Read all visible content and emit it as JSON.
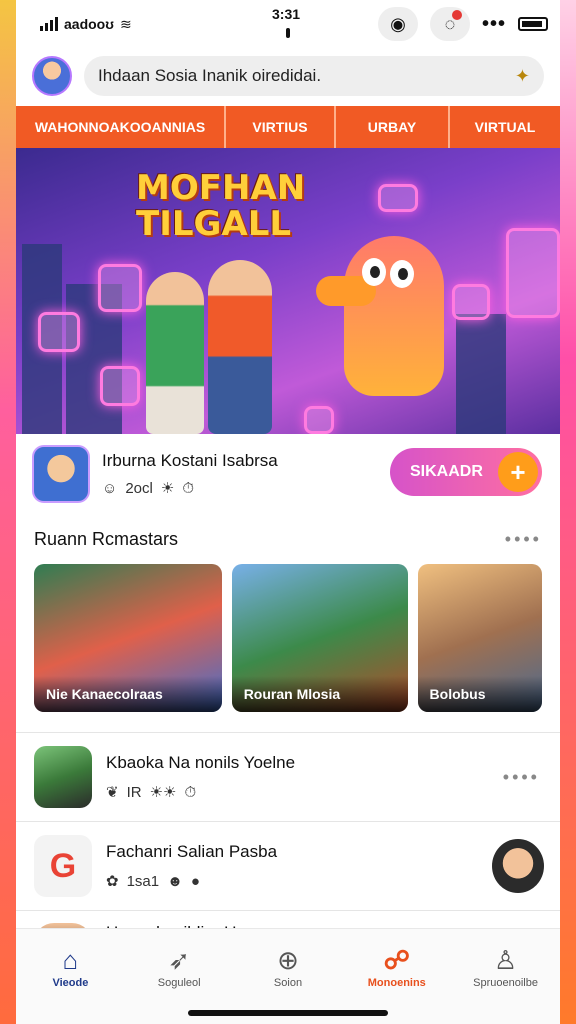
{
  "status": {
    "carrier": "aadooʊ",
    "time": "3:31"
  },
  "search": {
    "placeholder": "Ihdaan Sosia Inanik oiredidai."
  },
  "tabs": [
    {
      "label": "WAHONNOAKOOANNIAS"
    },
    {
      "label": "VIRTIUS"
    },
    {
      "label": "URBAY"
    },
    {
      "label": "VIRTUAL"
    }
  ],
  "hero": {
    "title_line1": "MOFHAN",
    "title_line2": "TILGALL"
  },
  "profile": {
    "name": "Irburna Kostani Isabrsa",
    "meta": "2ocl",
    "cta_label": "SIKAADR",
    "cta_plus": "+"
  },
  "section": {
    "title": "Ruann Rcmastars",
    "more": "••••"
  },
  "cards": [
    {
      "caption": "Nie Kanaecolraas"
    },
    {
      "caption": "Rouran Mlosia"
    },
    {
      "caption": "Bolobus"
    }
  ],
  "list": [
    {
      "title": "Kbaoka Na nonils Yoelne",
      "meta": "IR",
      "more": "••••"
    },
    {
      "title": "Fachanri Salian Pasba",
      "meta": "1sa1"
    },
    {
      "title": "Houngbesildiar Urusa"
    }
  ],
  "nav": [
    {
      "label": "Vieode",
      "icon": "home-icon"
    },
    {
      "label": "Soguleol",
      "icon": "compass-icon"
    },
    {
      "label": "Soion",
      "icon": "plus-icon"
    },
    {
      "label": "Monoenins",
      "icon": "notification-icon"
    },
    {
      "label": "Spruoenoilbe",
      "icon": "profile-icon"
    }
  ],
  "colors": {
    "accent": "#f15a24",
    "cta": "#d653c9",
    "plus": "#ff9d1a"
  }
}
